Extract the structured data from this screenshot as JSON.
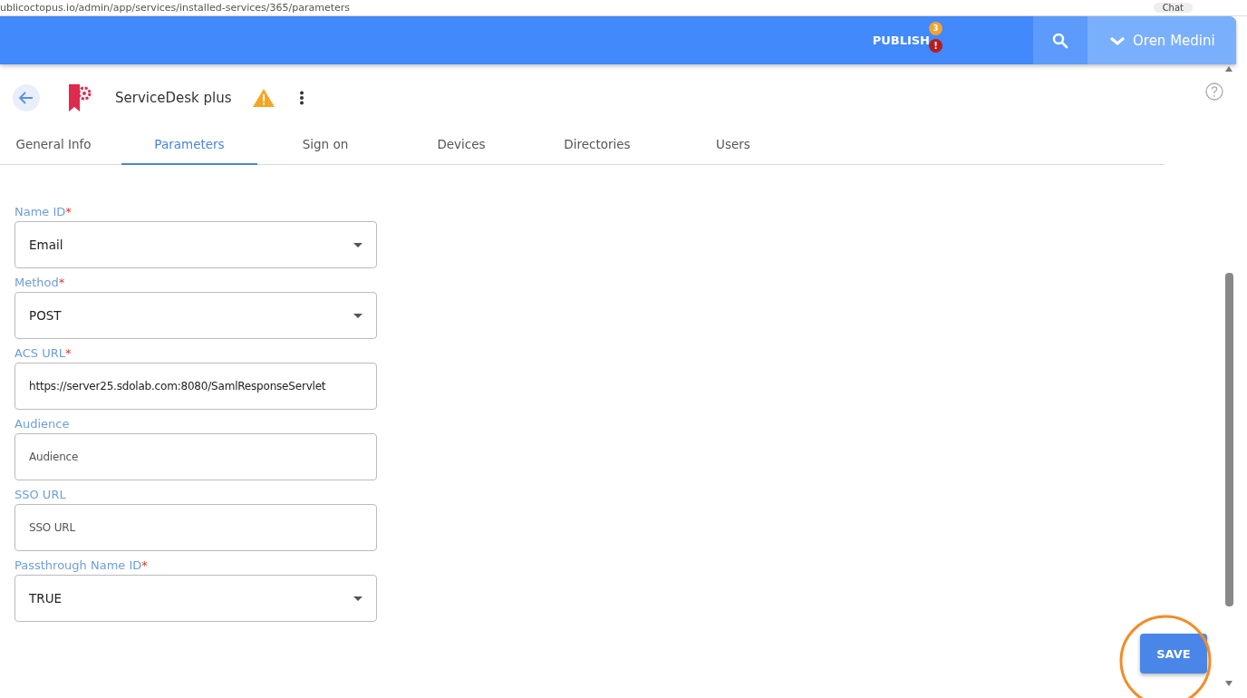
{
  "browser": {
    "url": "ublicoctopus.io/admin/app/services/installed-services/365/parameters",
    "chat": "Chat"
  },
  "topbar": {
    "publish": "PUBLISH",
    "publish_count": "3",
    "publish_alert": "!",
    "user": "Oren Medini"
  },
  "header": {
    "title": "ServiceDesk plus",
    "warning": true
  },
  "tabs": [
    {
      "label": "General Info",
      "selected": false
    },
    {
      "label": "Parameters",
      "selected": true
    },
    {
      "label": "Sign on",
      "selected": false
    },
    {
      "label": "Devices",
      "selected": false
    },
    {
      "label": "Directories",
      "selected": false
    },
    {
      "label": "Users",
      "selected": false
    }
  ],
  "fields": [
    {
      "label": "Name ID",
      "required": true,
      "kind": "select",
      "value": "Email"
    },
    {
      "label": "Method",
      "required": true,
      "kind": "select",
      "value": "POST"
    },
    {
      "label": "ACS URL",
      "required": true,
      "kind": "text",
      "value": "https://server25.sdolab.com:8080/SamlResponseServlet"
    },
    {
      "label": "Audience",
      "required": false,
      "kind": "text",
      "placeholder": "Audience"
    },
    {
      "label": "SSO URL",
      "required": false,
      "kind": "text",
      "placeholder": "SSO URL"
    },
    {
      "label": "Passthrough Name ID",
      "required": true,
      "kind": "select",
      "value": "TRUE"
    }
  ],
  "required_mark": "*",
  "save_button": "SAVE"
}
